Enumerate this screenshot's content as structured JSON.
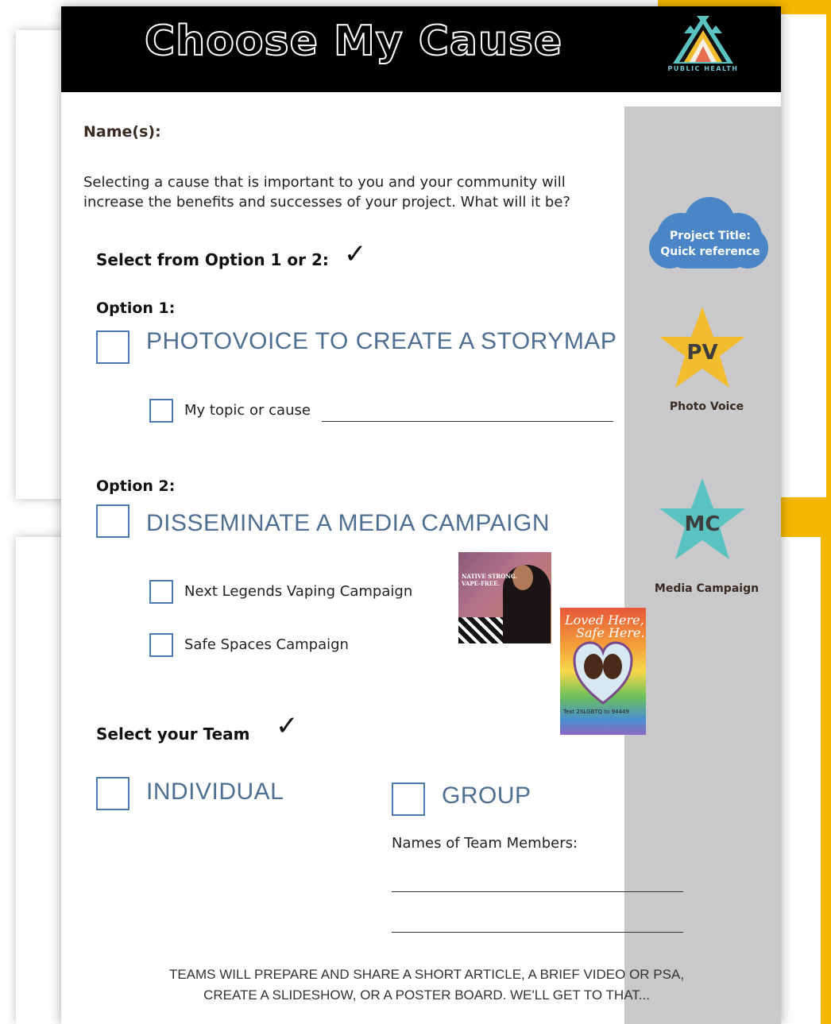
{
  "header": {
    "title": "Choose My Cause",
    "logo_text": "PUBLIC HEALTH"
  },
  "form": {
    "names_label": "Name(s):",
    "intro": "Selecting a cause that is important to you and your community will increase the benefits and successes of your project. What will it be?",
    "select_option_label": "Select from Option 1 or 2:",
    "option1": {
      "heading": "Option 1:",
      "title": "PHOTOVOICE TO CREATE A STORYMAP",
      "sub_item": "My topic or cause"
    },
    "option2": {
      "heading": "Option 2:",
      "title": "DISSEMINATE A MEDIA CAMPAIGN",
      "items": [
        "Next Legends Vaping Campaign",
        "Safe Spaces Campaign"
      ]
    },
    "team": {
      "label": "Select your Team",
      "individual": "INDIVIDUAL",
      "group": "GROUP",
      "members_label": "Names of Team Members:"
    },
    "footer": [
      "TEAMS WILL PREPARE AND SHARE A SHORT ARTICLE, A BRIEF VIDEO OR PSA,",
      "CREATE A SLIDESHOW, OR A POSTER BOARD. WE'LL GET TO THAT..."
    ]
  },
  "sidebar": {
    "cloud": [
      "Project Title:",
      "Quick reference"
    ],
    "pv": {
      "badge": "PV",
      "label": "Photo Voice",
      "color": "#f1bd2e"
    },
    "mc": {
      "badge": "MC",
      "label": "Media Campaign",
      "color": "#5bc2c2"
    }
  },
  "images": {
    "vape_poster": [
      "NATIVE STRONG.",
      "VAPE-FREE."
    ],
    "safe_poster": {
      "headline": [
        "Loved Here,",
        "Safe Here."
      ],
      "text": "Text 2SLGBTQ to 94449"
    }
  },
  "colors": {
    "accent_yellow": "#f5b800",
    "checkbox_blue": "#4a7ab0",
    "caps_blue": "#4e6f92",
    "sidebar_gray": "#c9c9cb",
    "cloud_blue": "#4a86c5"
  }
}
